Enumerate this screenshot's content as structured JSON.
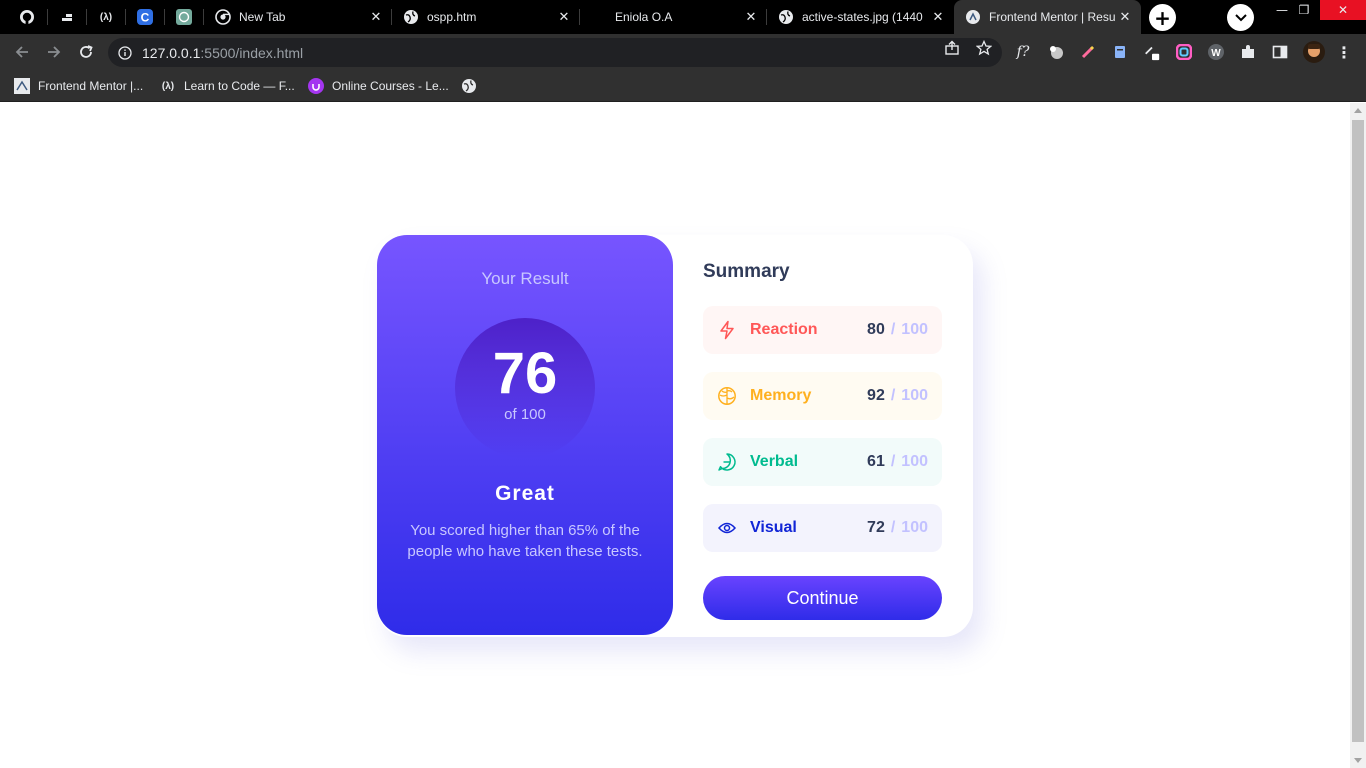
{
  "browser": {
    "tabs": [
      {
        "title": "",
        "icon": "github-icon"
      },
      {
        "title": "",
        "icon": "app-icon"
      },
      {
        "title": "",
        "icon": "freecodecamp-icon"
      },
      {
        "title": "",
        "icon": "c-icon"
      },
      {
        "title": "",
        "icon": "chatgpt-icon"
      },
      {
        "title": "New Tab",
        "icon": "chrome-icon"
      },
      {
        "title": "ospp.htm",
        "icon": "globe-icon"
      },
      {
        "title": "Eniola O.A",
        "icon": ""
      },
      {
        "title": "active-states.jpg (1440",
        "icon": "globe-icon"
      },
      {
        "title": "Frontend Mentor | Resu",
        "icon": "frontend-mentor-icon"
      }
    ],
    "url_host": "127.0.0.1",
    "url_path": ":5500/index.html",
    "bookmarks": [
      {
        "label": "Frontend Mentor |...",
        "icon": "frontend-mentor-icon"
      },
      {
        "label": "Learn to Code — F...",
        "icon": "freecodecamp-icon"
      },
      {
        "label": "Online Courses - Le...",
        "icon": "udemy-icon"
      },
      {
        "label": "",
        "icon": "globe-icon"
      }
    ]
  },
  "result": {
    "heading": "Your Result",
    "score": "76",
    "out_of": "of 100",
    "grade": "Great",
    "description": "You scored higher than 65% of the people who have taken these tests."
  },
  "summary": {
    "heading": "Summary",
    "items": [
      {
        "label": "Reaction",
        "score": "80",
        "sep": "/",
        "max": "100",
        "icon": "lightning-icon",
        "color": "#ff5757",
        "bg": "#fff6f5"
      },
      {
        "label": "Memory",
        "score": "92",
        "sep": "/",
        "max": "100",
        "icon": "brain-icon",
        "color": "#ffb01f",
        "bg": "#fffbf2"
      },
      {
        "label": "Verbal",
        "score": "61",
        "sep": "/",
        "max": "100",
        "icon": "chat-icon",
        "color": "#00bb8f",
        "bg": "#f2fbfa"
      },
      {
        "label": "Visual",
        "score": "72",
        "sep": "/",
        "max": "100",
        "icon": "eye-icon",
        "color": "#1125d6",
        "bg": "#f3f3fd"
      }
    ],
    "continue_label": "Continue"
  }
}
